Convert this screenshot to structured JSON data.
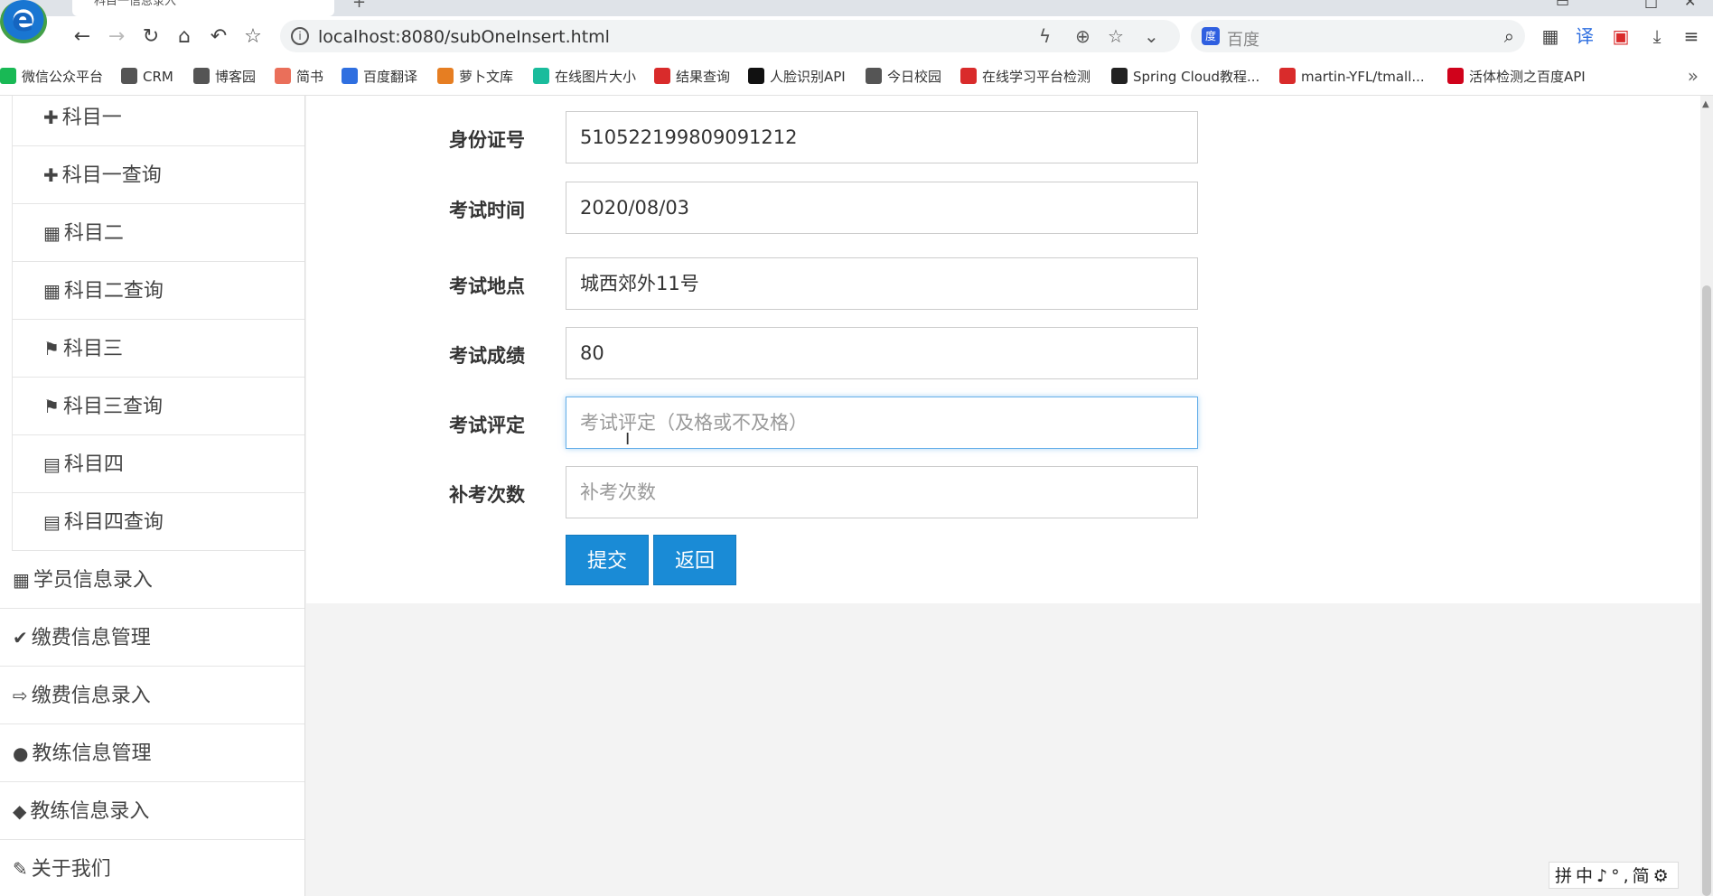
{
  "browser": {
    "tab_title": "科目一信息录入",
    "url": "localhost:8080/subOneInsert.html",
    "search_placeholder": "百度",
    "bookmarks": [
      {
        "label": "微信公众平台",
        "color": "#19b955"
      },
      {
        "label": "CRM",
        "color": "#555555"
      },
      {
        "label": "博客园",
        "color": "#555555"
      },
      {
        "label": "简书",
        "color": "#ea6f5a"
      },
      {
        "label": "百度翻译",
        "color": "#2f6fe0"
      },
      {
        "label": "萝卜文库",
        "color": "#e67e22"
      },
      {
        "label": "在线图片大小",
        "color": "#1abc9c"
      },
      {
        "label": "结果查询",
        "color": "#d92b2b"
      },
      {
        "label": "人脸识别API",
        "color": "#111111"
      },
      {
        "label": "今日校园",
        "color": "#555555"
      },
      {
        "label": "在线学习平台检测",
        "color": "#d92b2b"
      },
      {
        "label": "Spring Cloud教程...",
        "color": "#222222"
      },
      {
        "label": "martin-YFL/tmall...",
        "color": "#d92b2b"
      },
      {
        "label": "活体检测之百度API",
        "color": "#d0021b"
      }
    ],
    "more": "»"
  },
  "sidebar": {
    "sub_items": [
      {
        "icon": "puzzle-icon",
        "glyph": "✚",
        "label": "科目一"
      },
      {
        "icon": "puzzle-icon",
        "glyph": "✚",
        "label": "科目一查询"
      },
      {
        "icon": "grid-icon",
        "glyph": "▦",
        "label": "科目二"
      },
      {
        "icon": "grid-icon",
        "glyph": "▦",
        "label": "科目二查询"
      },
      {
        "icon": "bookmark-icon",
        "glyph": "⚑",
        "label": "科目三"
      },
      {
        "icon": "bookmark-icon",
        "glyph": "⚑",
        "label": "科目三查询"
      },
      {
        "icon": "calendar-icon",
        "glyph": "▤",
        "label": "科目四"
      },
      {
        "icon": "calendar-icon",
        "glyph": "▤",
        "label": "科目四查询"
      }
    ],
    "top_items": [
      {
        "icon": "table-icon",
        "glyph": "▦",
        "label": "学员信息录入"
      },
      {
        "icon": "check-icon",
        "glyph": "✔",
        "label": "缴费信息管理"
      },
      {
        "icon": "sign-out-icon",
        "glyph": "⇨",
        "label": "缴费信息录入"
      },
      {
        "icon": "users-icon",
        "glyph": "●",
        "label": "教练信息管理"
      },
      {
        "icon": "tag-icon",
        "glyph": "◆",
        "label": "教练信息录入"
      },
      {
        "icon": "edit-icon",
        "glyph": "✎",
        "label": "关于我们"
      }
    ]
  },
  "form": {
    "fields": [
      {
        "label": "身份证号",
        "value": "510522199809091212",
        "placeholder": ""
      },
      {
        "label": "考试时间",
        "value": "2020/08/03",
        "placeholder": ""
      },
      {
        "label": "考试地点",
        "value": "城西郊外11号",
        "placeholder": ""
      },
      {
        "label": "考试成绩",
        "value": "80",
        "placeholder": ""
      },
      {
        "label": "考试评定",
        "value": "",
        "placeholder": "考试评定（及格或不及格）"
      },
      {
        "label": "补考次数",
        "value": "",
        "placeholder": "补考次数"
      }
    ],
    "submit_label": "提交",
    "back_label": "返回"
  },
  "ime": {
    "text": "拼中♪°,简⚙"
  },
  "colors": {
    "button": "#1a8bd6",
    "focus_border": "#66afe9"
  }
}
